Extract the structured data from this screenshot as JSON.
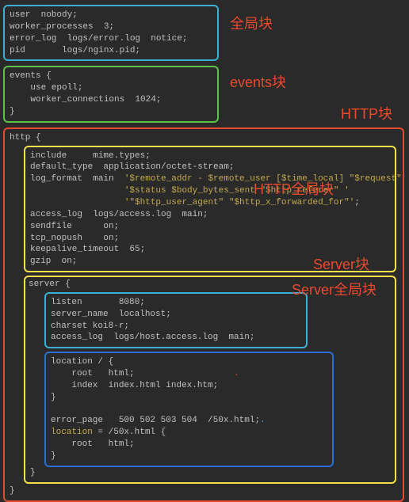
{
  "labels": {
    "global": "全局块",
    "events": "events块",
    "httpOuter": "HTTP块",
    "httpGlobal": "HTTP全局块",
    "server": "Server块",
    "serverGlobal": "Server全局块"
  },
  "code": {
    "global": "user  nobody;\nworker_processes  3;\nerror_log  logs/error.log  notice;\npid       logs/nginx.pid;",
    "events": "events {\n    use epoll;\n    worker_connections  1024;\n}",
    "httpOpen": "http {",
    "httpGlobal_l1": "include     mime.types;",
    "httpGlobal_l2": "default_type  application/octet-stream;",
    "httpGlobal_l3a": "log_format  main  ",
    "httpGlobal_s1": "'$remote_addr - $remote_user [$time_local] \"$request\" '",
    "httpGlobal_s2": "'$status $body_bytes_sent \"$http_referer\" '",
    "httpGlobal_s3": "'\"$http_user_agent\" \"$http_x_forwarded_for\"'",
    "httpGlobal_l4": "access_log  logs/access.log  main;",
    "httpGlobal_l5": "sendfile      on;",
    "httpGlobal_l6": "tcp_nopush    on;",
    "httpGlobal_l7": "keepalive_timeout  65;",
    "httpGlobal_l8": "gzip  on;",
    "serverOpen": "server {",
    "serverGlobal": "listen       8080;\nserver_name  localhost;\ncharset koi8-r;\naccess_log  logs/host.access.log  main;",
    "location_l1": "location / {",
    "location_l2": "    root   html;",
    "location_l3": "    index  index.html index.htm;",
    "location_l4": "}",
    "location_l5": "",
    "location_l6": "error_page   500 502 503 504  /50x.html;",
    "location_l7a": "location",
    "location_l7b": " = /50x.html {",
    "location_l8": "    root   html;",
    "location_l9": "}",
    "serverClose": "}",
    "httpClose": "}",
    "semicolon": ";"
  }
}
